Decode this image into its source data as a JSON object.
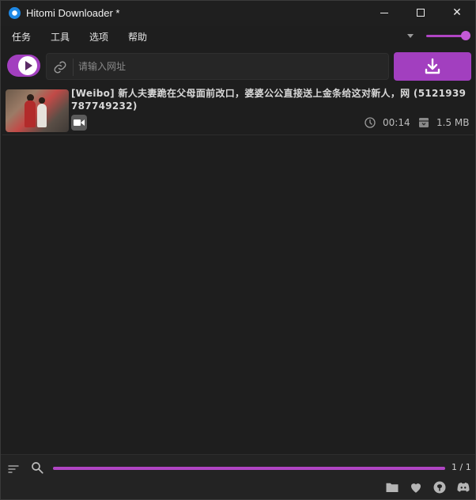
{
  "window": {
    "title": "Hitomi Downloader *",
    "controls": {
      "minimize": "minimize-icon",
      "maximize": "maximize-icon",
      "close": "✕"
    }
  },
  "menu": {
    "items": [
      {
        "label": "任务"
      },
      {
        "label": "工具"
      },
      {
        "label": "选项"
      },
      {
        "label": "帮助"
      }
    ],
    "volume": 1.0
  },
  "toolbar": {
    "url_placeholder": "请输入网址",
    "url_value": "",
    "accent": "#a23fbf"
  },
  "tasks": [
    {
      "title": "[Weibo] 新人夫妻跪在父母面前改口，婆婆公公直接送上金条给这对新人，网 (5121939787749232)",
      "type_icon": "video-icon",
      "duration": "00:14",
      "size": "1.5 MB"
    }
  ],
  "footer": {
    "progress": 1.0,
    "page": "1 / 1",
    "icons": [
      "folder-icon",
      "heart-icon",
      "github-icon",
      "discord-icon"
    ]
  }
}
